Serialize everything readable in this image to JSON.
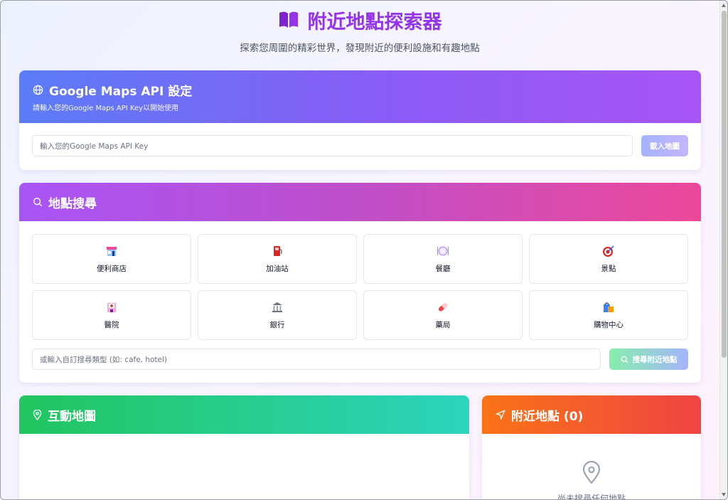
{
  "header": {
    "title": "附近地點探索器",
    "subtitle": "探索您周圍的精彩世界，發現附近的便利設施和有趣地點",
    "icon": "book-icon"
  },
  "api_card": {
    "title": "Google Maps API 設定",
    "description": "請輸入您的Google Maps API Key以開始使用",
    "input_placeholder": "輸入您的Google Maps API Key",
    "button_label": "載入地圖",
    "icon": "globe-icon"
  },
  "search_card": {
    "title": "地點搜尋",
    "icon": "search-icon",
    "categories": [
      {
        "label": "便利商店",
        "icon": "convenience-store-icon"
      },
      {
        "label": "加油站",
        "icon": "fuel-pump-icon"
      },
      {
        "label": "餐廳",
        "icon": "plate-cutlery-icon"
      },
      {
        "label": "景點",
        "icon": "target-dart-icon"
      },
      {
        "label": "醫院",
        "icon": "hospital-icon"
      },
      {
        "label": "銀行",
        "icon": "bank-icon"
      },
      {
        "label": "藥局",
        "icon": "pill-icon"
      },
      {
        "label": "購物中心",
        "icon": "shopping-bags-icon"
      }
    ],
    "custom_placeholder": "或輸入自訂搜尋類型 (如: cafe, hotel)",
    "search_button_label": "搜尋附近地點"
  },
  "map_card": {
    "title": "互動地圖",
    "icon": "map-pin-icon"
  },
  "nearby_card": {
    "title": "附近地點 (0)",
    "icon": "navigation-arrow-icon",
    "empty_text": "尚未搜尋任何地點",
    "empty_icon": "map-pin-icon"
  },
  "colors": {
    "title": "#9333ea",
    "api_header_start": "#5b7cf7",
    "api_header_end": "#a855f7",
    "search_header_start": "#a855f7",
    "search_header_end": "#ec4899",
    "map_header_start": "#22c55e",
    "map_header_end": "#2dd4bf",
    "nearby_header_start": "#f97316",
    "nearby_header_end": "#ef4444"
  }
}
